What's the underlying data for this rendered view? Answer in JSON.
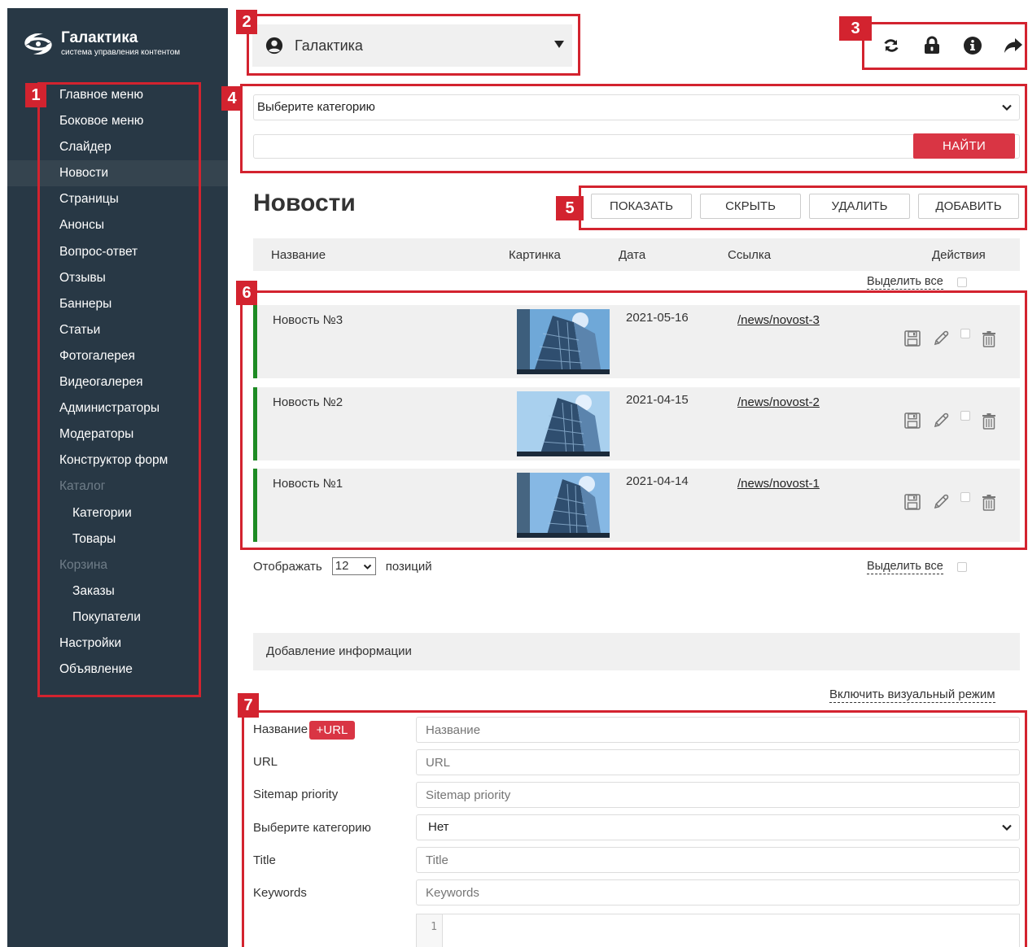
{
  "app": {
    "title": "Галактика",
    "subtitle": "система управления контентом"
  },
  "sidebar": {
    "items": [
      {
        "label": "Главное меню",
        "kind": "item"
      },
      {
        "label": "Боковое меню",
        "kind": "item"
      },
      {
        "label": "Слайдер",
        "kind": "item"
      },
      {
        "label": "Новости",
        "kind": "item",
        "active": true
      },
      {
        "label": "Страницы",
        "kind": "item"
      },
      {
        "label": "Анонсы",
        "kind": "item"
      },
      {
        "label": "Вопрос-ответ",
        "kind": "item"
      },
      {
        "label": "Отзывы",
        "kind": "item"
      },
      {
        "label": "Баннеры",
        "kind": "item"
      },
      {
        "label": "Статьи",
        "kind": "item"
      },
      {
        "label": "Фотогалерея",
        "kind": "item"
      },
      {
        "label": "Видеогалерея",
        "kind": "item"
      },
      {
        "label": "Администраторы",
        "kind": "item"
      },
      {
        "label": "Модераторы",
        "kind": "item"
      },
      {
        "label": "Конструктор форм",
        "kind": "item"
      },
      {
        "label": "Каталог",
        "kind": "group"
      },
      {
        "label": "Категории",
        "kind": "sub"
      },
      {
        "label": "Товары",
        "kind": "sub"
      },
      {
        "label": "Корзина",
        "kind": "group"
      },
      {
        "label": "Заказы",
        "kind": "sub"
      },
      {
        "label": "Покупатели",
        "kind": "sub"
      },
      {
        "label": "Настройки",
        "kind": "item"
      },
      {
        "label": "Объявление",
        "kind": "item"
      }
    ]
  },
  "site_selector": {
    "value": "Галактика",
    "icon": "user-circle-icon"
  },
  "top_actions": [
    {
      "name": "refresh-icon"
    },
    {
      "name": "lock-icon"
    },
    {
      "name": "info-icon"
    },
    {
      "name": "share-icon"
    }
  ],
  "filter": {
    "category_value": "Выберите категорию",
    "search_value": "",
    "find_label": "НАЙТИ"
  },
  "page": {
    "title": "Новости"
  },
  "buttons": {
    "show": "ПОКАЗАТЬ",
    "hide": "СКРЫТЬ",
    "delete": "УДАЛИТЬ",
    "add": "ДОБАВИТЬ"
  },
  "table": {
    "headers": {
      "name": "Название",
      "image": "Картинка",
      "date": "Дата",
      "link": "Ссылка",
      "actions": "Действия"
    },
    "select_all": "Выделить все",
    "rows": [
      {
        "name": "Новость №3",
        "date": "2021-05-16",
        "link": "/news/novost-3",
        "checked": false
      },
      {
        "name": "Новость №2",
        "date": "2021-04-15",
        "link": "/news/novost-2",
        "checked": false
      },
      {
        "name": "Новость №1",
        "date": "2021-04-14",
        "link": "/news/novost-1",
        "checked": false
      }
    ]
  },
  "pagination": {
    "prefix": "Отображать",
    "value": "12",
    "suffix": "позиций"
  },
  "add_form": {
    "section_title": "Добавление информации",
    "visual_mode": "Включить визуальный режим",
    "url_badge": "+URL",
    "fields": {
      "name": {
        "label": "Название",
        "placeholder": "Название"
      },
      "url": {
        "label": "URL",
        "placeholder": "URL"
      },
      "sitemap": {
        "label": "Sitemap priority",
        "placeholder": "Sitemap priority"
      },
      "category": {
        "label": "Выберите категорию",
        "value": "Нет"
      },
      "title": {
        "label": "Title",
        "placeholder": "Title"
      },
      "keywords": {
        "label": "Keywords",
        "placeholder": "Keywords"
      }
    },
    "editor_line": "1"
  },
  "callouts": [
    "1",
    "2",
    "3",
    "4",
    "5",
    "6",
    "7"
  ],
  "colors": {
    "sidebar_bg": "#283845",
    "accent_red": "#d93544",
    "callout_red": "#d3232f",
    "row_marker_green": "#1e8b24"
  }
}
